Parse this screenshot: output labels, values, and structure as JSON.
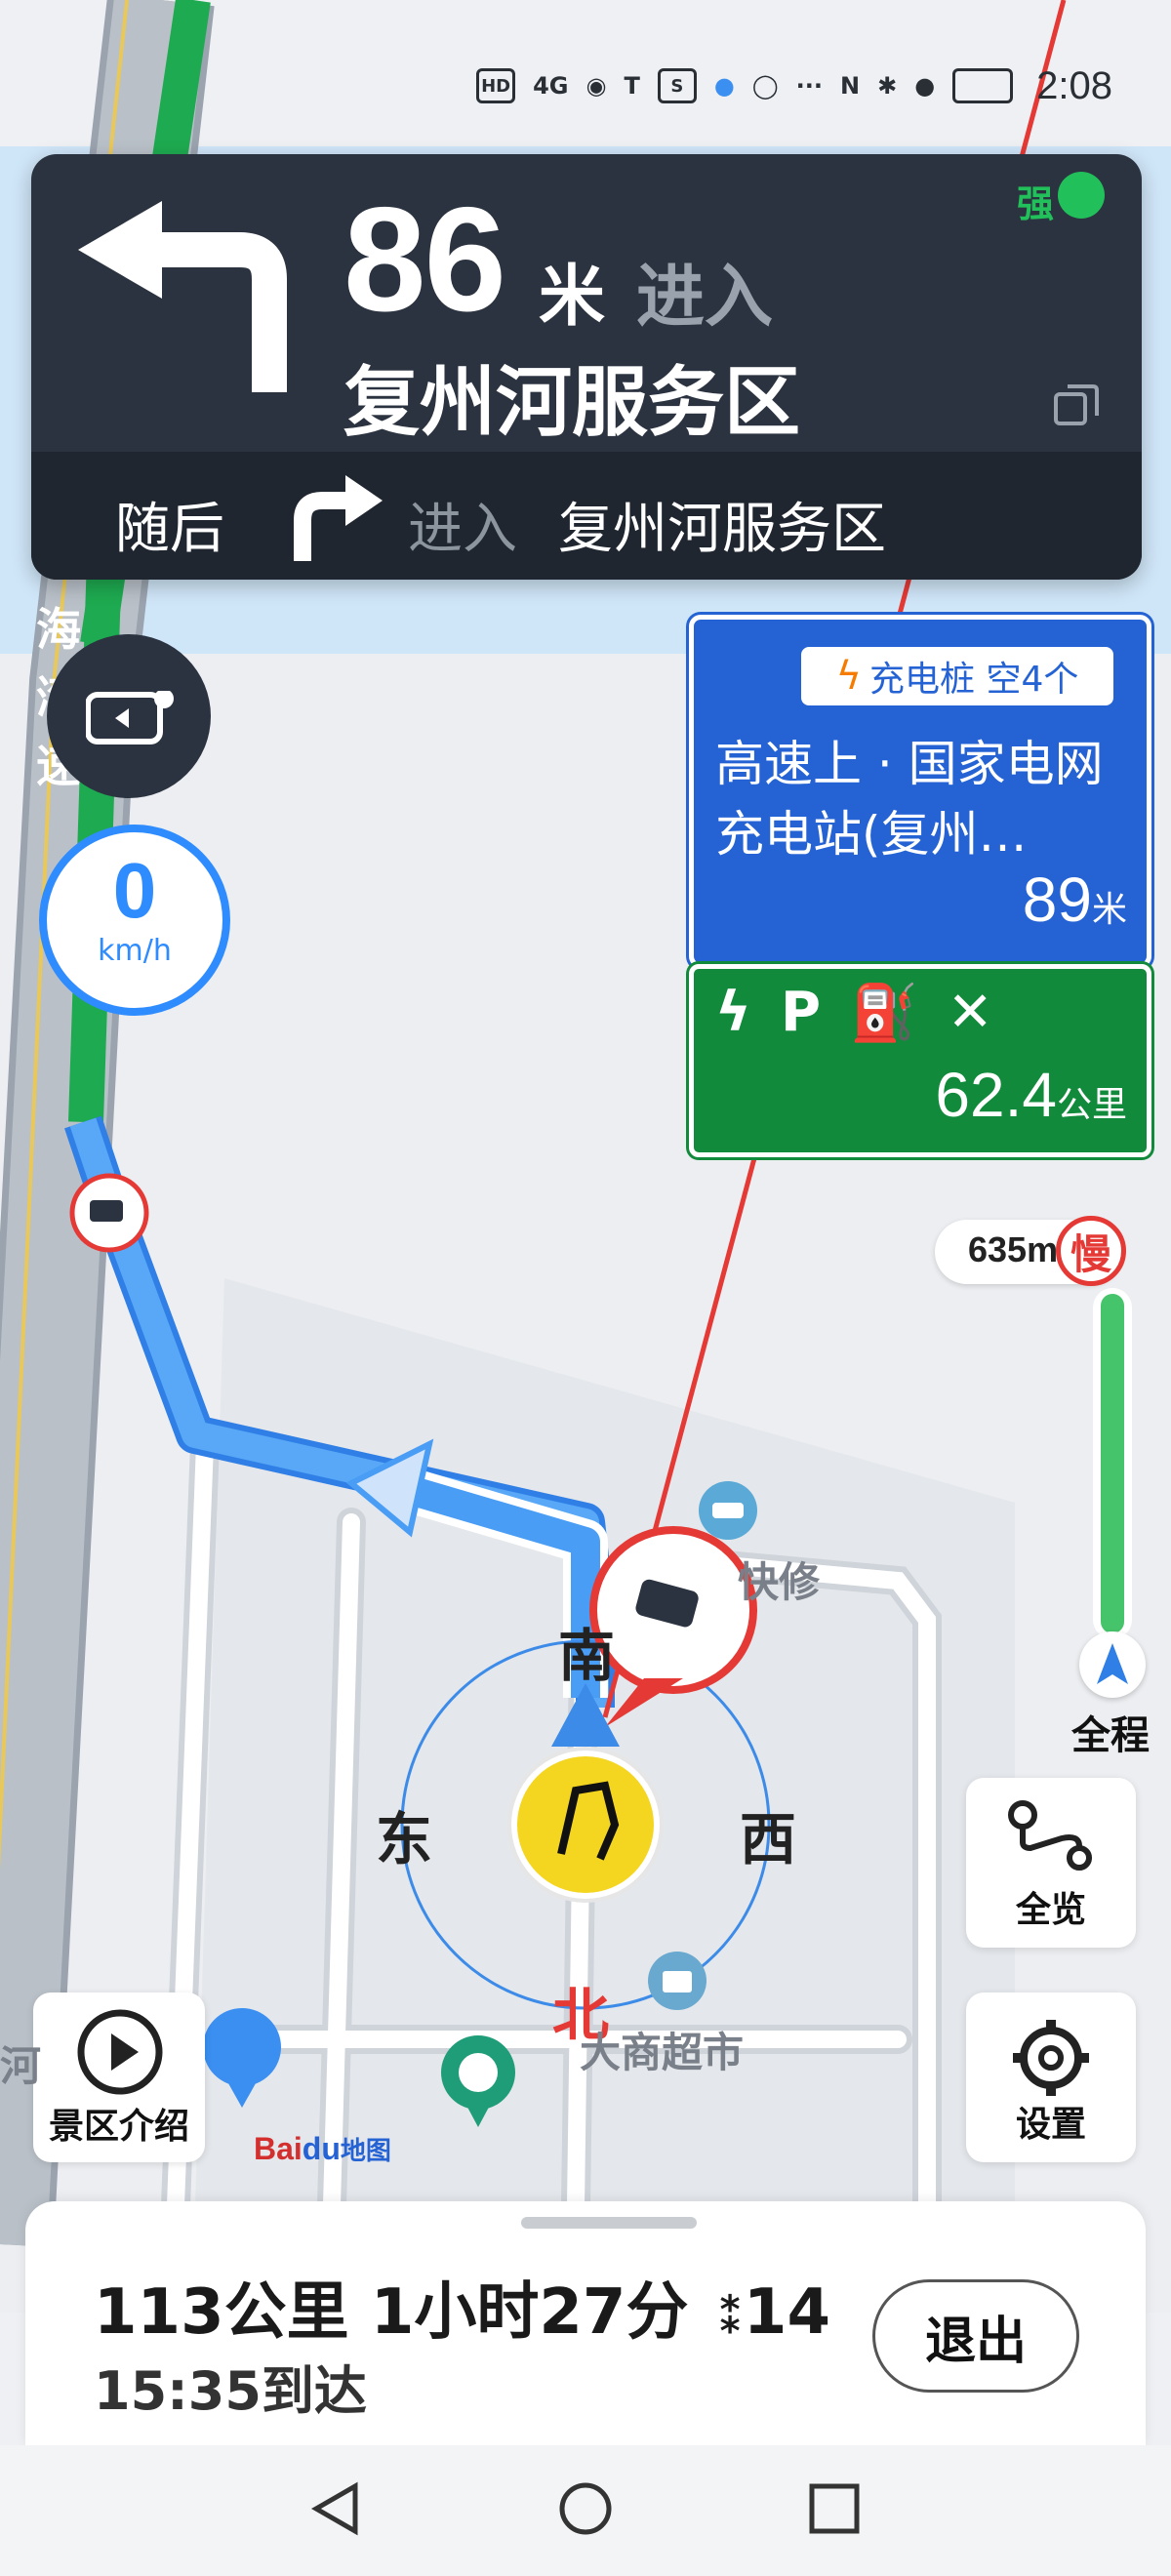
{
  "status_bar": {
    "left_icons": [
      "hd-icon",
      "4g-signal-icon",
      "app-icon",
      "tesla-icon",
      "sina-icon",
      "browser-icon",
      "chat-icon",
      "more-dots-icon"
    ],
    "right_icons": [
      "nfc-icon",
      "bluetooth-icon",
      "location-icon",
      "battery-icon"
    ],
    "hd": "HD",
    "net": "4G",
    "more": "···",
    "time": "2:08"
  },
  "nav_card": {
    "distance": "86",
    "distance_unit": "米",
    "action": "进入",
    "road": "复州河服务区",
    "signal": "强",
    "next_label": "随后",
    "next_action": "进入",
    "next_road": "复州河服务区",
    "turn": "left",
    "next_turn": "right"
  },
  "speed": {
    "value": "0",
    "unit": "km/h"
  },
  "charging": {
    "badge": "充电桩 空4个",
    "name": "高速上 · 国家电网充电站(复州…",
    "distance": "89",
    "distance_unit": "米"
  },
  "service_area": {
    "icons": [
      "charging-icon",
      "parking-icon",
      "fuel-icon",
      "restaurant-icon"
    ],
    "distance": "62.4",
    "distance_unit": "公里"
  },
  "progress": {
    "remaining": "635m",
    "slow_badge": "慢",
    "full_label": "全程",
    "traffic_color": "#46c46b",
    "progress_fraction": 0.97
  },
  "map": {
    "road_label": "海\n湾\n速",
    "compass": {
      "south": "南",
      "east": "东",
      "west": "西",
      "north": "北"
    },
    "poi": {
      "repair": "快修",
      "supermarket": "大商超市",
      "river": "河"
    },
    "baidu_logo": "Bai",
    "baidu_logo_du": "du",
    "baidu_logo_map": "地图",
    "route_color": "#4a9df5",
    "road_green": "#1eaa50"
  },
  "buttons": {
    "overview": "全览",
    "settings": "设置",
    "scenic": "景区介绍"
  },
  "trip": {
    "distance": "113公里",
    "time": "1小时27分",
    "lights": "14",
    "eta": "15:35到达",
    "exit": "退出"
  }
}
